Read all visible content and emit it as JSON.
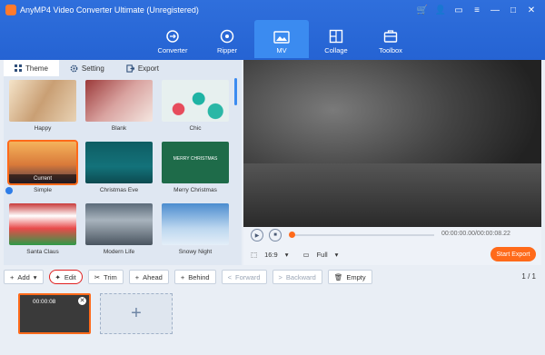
{
  "app": {
    "title": "AnyMP4 Video Converter Ultimate (Unregistered)",
    "window_controls": [
      "cart-icon",
      "user-icon",
      "chat-icon",
      "menu-icon",
      "minimize-icon",
      "maximize-icon",
      "close-icon"
    ]
  },
  "main_tabs": [
    {
      "label": "Converter",
      "icon": "converter-icon"
    },
    {
      "label": "Ripper",
      "icon": "ripper-icon"
    },
    {
      "label": "MV",
      "icon": "mv-icon",
      "active": true
    },
    {
      "label": "Collage",
      "icon": "collage-icon"
    },
    {
      "label": "Toolbox",
      "icon": "toolbox-icon"
    }
  ],
  "left_tabs": [
    {
      "label": "Theme",
      "active": true
    },
    {
      "label": "Setting"
    },
    {
      "label": "Export"
    }
  ],
  "themes": [
    {
      "label": "Happy"
    },
    {
      "label": "Blank"
    },
    {
      "label": "Chic"
    },
    {
      "label": "Simple",
      "selected": true,
      "tag": "Current"
    },
    {
      "label": "Christmas Eve"
    },
    {
      "label": "Merry Christmas",
      "thumb_text": "MERRY CHRISTMAS"
    },
    {
      "label": "Santa Claus"
    },
    {
      "label": "Modern Life"
    },
    {
      "label": "Snowy Night"
    }
  ],
  "player": {
    "timecode": "00:00:00.00/00:00:08.22",
    "aspect": "16:9",
    "zoom": "Full",
    "start_export": "Start Export"
  },
  "toolbar": {
    "add": "Add",
    "edit": "Edit",
    "trim": "Trim",
    "ahead": "Ahead",
    "behind": "Behind",
    "forward": "Forward",
    "backward": "Backward",
    "empty": "Empty"
  },
  "pagination": "1 / 1",
  "clips": [
    {
      "time": "00:00:08"
    }
  ],
  "colors": {
    "accent": "#2563d3",
    "highlight": "#ff6a1a",
    "edit_ring": "#e02020"
  }
}
